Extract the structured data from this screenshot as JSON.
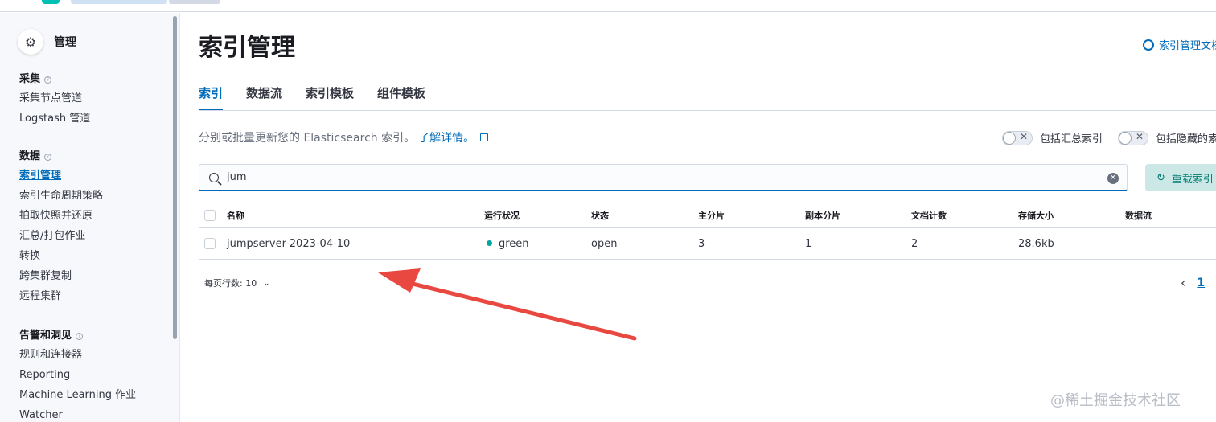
{
  "sidebar": {
    "title": "管理",
    "groups": [
      {
        "title": "采集",
        "items": [
          "采集节点管道",
          "Logstash 管道"
        ]
      },
      {
        "title": "数据",
        "items": [
          "索引管理",
          "索引生命周期策略",
          "拍取快照并还原",
          "汇总/打包作业",
          "转换",
          "跨集群复制",
          "远程集群"
        ]
      },
      {
        "title": "告警和洞见",
        "items": [
          "规则和连接器",
          "Reporting",
          "Machine Learning 作业",
          "Watcher"
        ]
      }
    ],
    "active_item": "索引管理"
  },
  "main": {
    "page_title": "索引管理",
    "doc_link": "索引管理文档",
    "tabs": [
      "索引",
      "数据流",
      "索引模板",
      "组件模板"
    ],
    "active_tab": "索引",
    "description": "分别或批量更新您的 Elasticsearch 索引。",
    "learn_more": "了解详情。",
    "toggles": [
      "包括汇总索引",
      "包括隐藏的索引"
    ],
    "search": {
      "value": "jum"
    },
    "reload_button": "重载索引",
    "table": {
      "columns": [
        "名称",
        "运行状况",
        "状态",
        "主分片",
        "副本分片",
        "文档计数",
        "存储大小",
        "数据流"
      ],
      "rows": [
        {
          "name": "jumpserver-2023-04-10",
          "health": "green",
          "status": "open",
          "primary": "3",
          "replica": "1",
          "docs": "2",
          "size": "28.6kb",
          "data_stream": ""
        }
      ]
    },
    "rows_per_page": "每页行数: 10",
    "pagination": {
      "current_page": "1"
    }
  },
  "colors": {
    "accent": "#006bb8",
    "health_green": "#00a69b",
    "annotation_arrow": "#e8483f"
  },
  "watermark": "@稀土掘金技术社区"
}
